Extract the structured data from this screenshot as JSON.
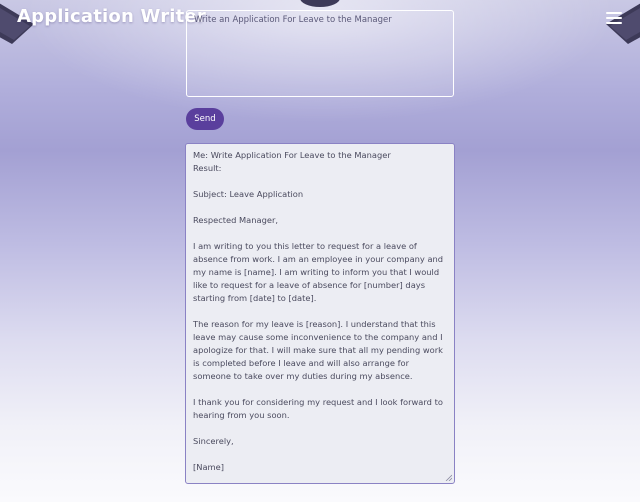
{
  "app": {
    "title": "Application Writer"
  },
  "icons": {
    "menu": "hamburger-menu-icon",
    "decor": "ceiling-lamp-icon"
  },
  "prompt": {
    "placeholder": "Write an Application For Leave to the Manager",
    "value": ""
  },
  "send_button": {
    "label": "Send"
  },
  "result": {
    "header_line": "Me: Write Application For Leave to the Manager",
    "result_label": "Result:",
    "subject": "Subject: Leave Application",
    "salutation": "Respected Manager,",
    "paragraph_1": "I am writing to you this letter to request for a leave of absence from work. I am an employee in your company and my name is [name]. I am writing to inform you that I would like to request for a leave of absence for [number] days starting from [date] to [date].",
    "paragraph_2": "The reason for my leave is [reason]. I understand that this leave may cause some inconvenience to the company and I apologize for that. I will make sure that all my pending work is completed before I leave and will also arrange for someone to take over my duties during my absence.",
    "paragraph_3": "I thank you for considering my request and I look forward to hearing from you soon.",
    "closing": "Sincerely,",
    "signature": "[Name]"
  },
  "colors": {
    "accent": "#5a3f9d",
    "result_border": "#8a82c4",
    "result_background": "#ecedf3"
  }
}
